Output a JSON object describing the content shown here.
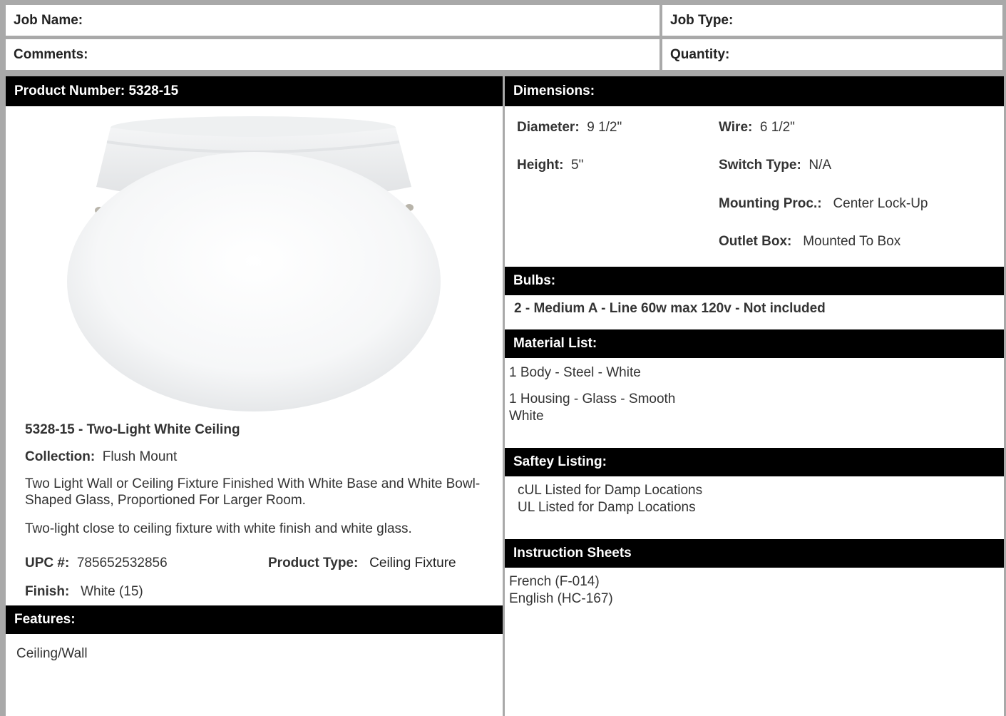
{
  "job": {
    "job_name_label": "Job Name:",
    "job_type_label": "Job Type:",
    "comments_label": "Comments:",
    "quantity_label": "Quantity:"
  },
  "product": {
    "header": "Product Number: 5328-15",
    "title": "5328-15 - Two-Light White Ceiling",
    "collection_label": "Collection:",
    "collection_value": "Flush Mount",
    "description_long": "Two Light Wall or Ceiling Fixture Finished With White Base and White Bowl-Shaped Glass, Proportioned For Larger Room.",
    "description_short": "Two-light close to ceiling fixture with white finish and white glass.",
    "upc_label": "UPC #:",
    "upc_value": "785652532856",
    "type_label": "Product Type:",
    "type_value": "Ceiling Fixture",
    "finish_label": "Finish:",
    "finish_value": "White (15)",
    "features_header": "Features:",
    "features_text": "Ceiling/Wall"
  },
  "dimensions": {
    "header": "Dimensions:",
    "diameter_label": "Diameter:",
    "diameter_value": "9 1/2\"",
    "height_label": "Height:",
    "height_value": "5\"",
    "wire_label": "Wire:",
    "wire_value": "6 1/2\"",
    "switch_label": "Switch Type:",
    "switch_value": "N/A",
    "mounting_label": "Mounting Proc.:",
    "mounting_value": "Center Lock-Up",
    "outlet_label": "Outlet Box:",
    "outlet_value": "Mounted To Box"
  },
  "bulbs": {
    "header": "Bulbs:",
    "text": "2 - Medium A - Line 60w max 120v - Not included"
  },
  "materials": {
    "header": "Material List:",
    "items": [
      "1 Body - Steel - White",
      "1 Housing - Glass - Smooth",
      "White"
    ]
  },
  "safety": {
    "header": "Saftey Listing:",
    "items": [
      "cUL Listed for Damp Locations",
      "UL Listed for Damp Locations"
    ]
  },
  "instructions": {
    "header": "Instruction Sheets",
    "items": [
      "French (F-014)",
      "English (HC-167)"
    ]
  }
}
